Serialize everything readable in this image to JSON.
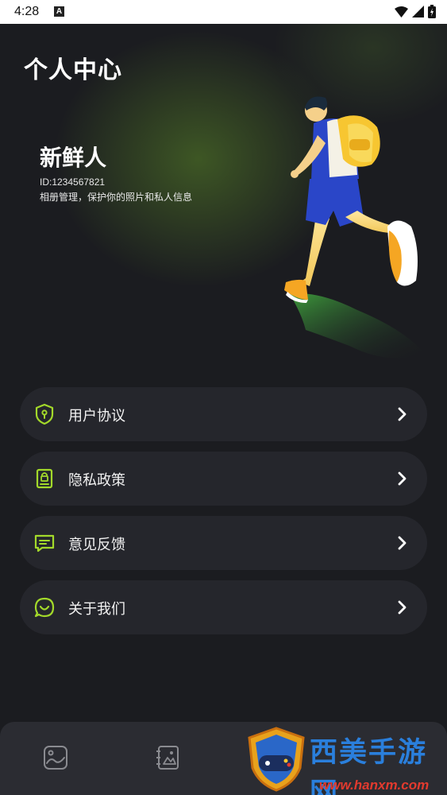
{
  "status_bar": {
    "time": "4:28",
    "notification_badge": "A"
  },
  "header": {
    "title": "个人中心"
  },
  "profile": {
    "name": "新鲜人",
    "id": "ID:1234567821",
    "description": "相册管理，保护你的照片和私人信息"
  },
  "menu": [
    {
      "label": "用户协议",
      "icon": "shield-icon"
    },
    {
      "label": "隐私政策",
      "icon": "privacy-doc-icon"
    },
    {
      "label": "意见反馈",
      "icon": "chat-feedback-icon"
    },
    {
      "label": "关于我们",
      "icon": "whatsapp-style-chat-icon"
    }
  ],
  "tabs": [
    {
      "icon": "photo-icon"
    },
    {
      "icon": "album-book-icon"
    },
    {
      "icon": "profile-tab-icon"
    }
  ],
  "watermark": {
    "text": "西美手游网",
    "url": "www.hanxm.com"
  },
  "colors": {
    "accent": "#a3d92a",
    "background": "#1b1c20",
    "card": "#25262c",
    "tabbar": "#2b2c32"
  }
}
